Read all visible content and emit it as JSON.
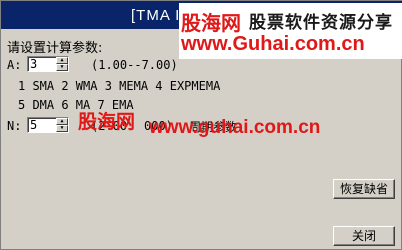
{
  "window": {
    "title": "[TMA I]"
  },
  "watermark": {
    "brand": "股海网",
    "tagline": "股票软件资源分享",
    "url": "www.Guhai.com.cn",
    "overlay_brand": "股海网",
    "overlay_url": "www.guhai.com.cn"
  },
  "form": {
    "prompt": "请设置计算参数:",
    "param_a": {
      "label": "A:",
      "value": "3",
      "range": "(1.00--7.00)"
    },
    "ma_types_line1": "1 SMA  2 WMA  3 MEMA 4 EXPMEMA",
    "ma_types_line2": "5 DMA  6 MA   7 EMA",
    "param_n": {
      "label": "N:",
      "value": "5",
      "range_fragment": "(2.00",
      "range_end": "000)",
      "desc": "周期参数"
    }
  },
  "buttons": {
    "restore_defaults": "恢复缺省",
    "close": "关闭"
  },
  "colors": {
    "dialog_bg": "#d4d0c8",
    "titlebar": "#0a246a",
    "watermark_red": "#e01818"
  }
}
